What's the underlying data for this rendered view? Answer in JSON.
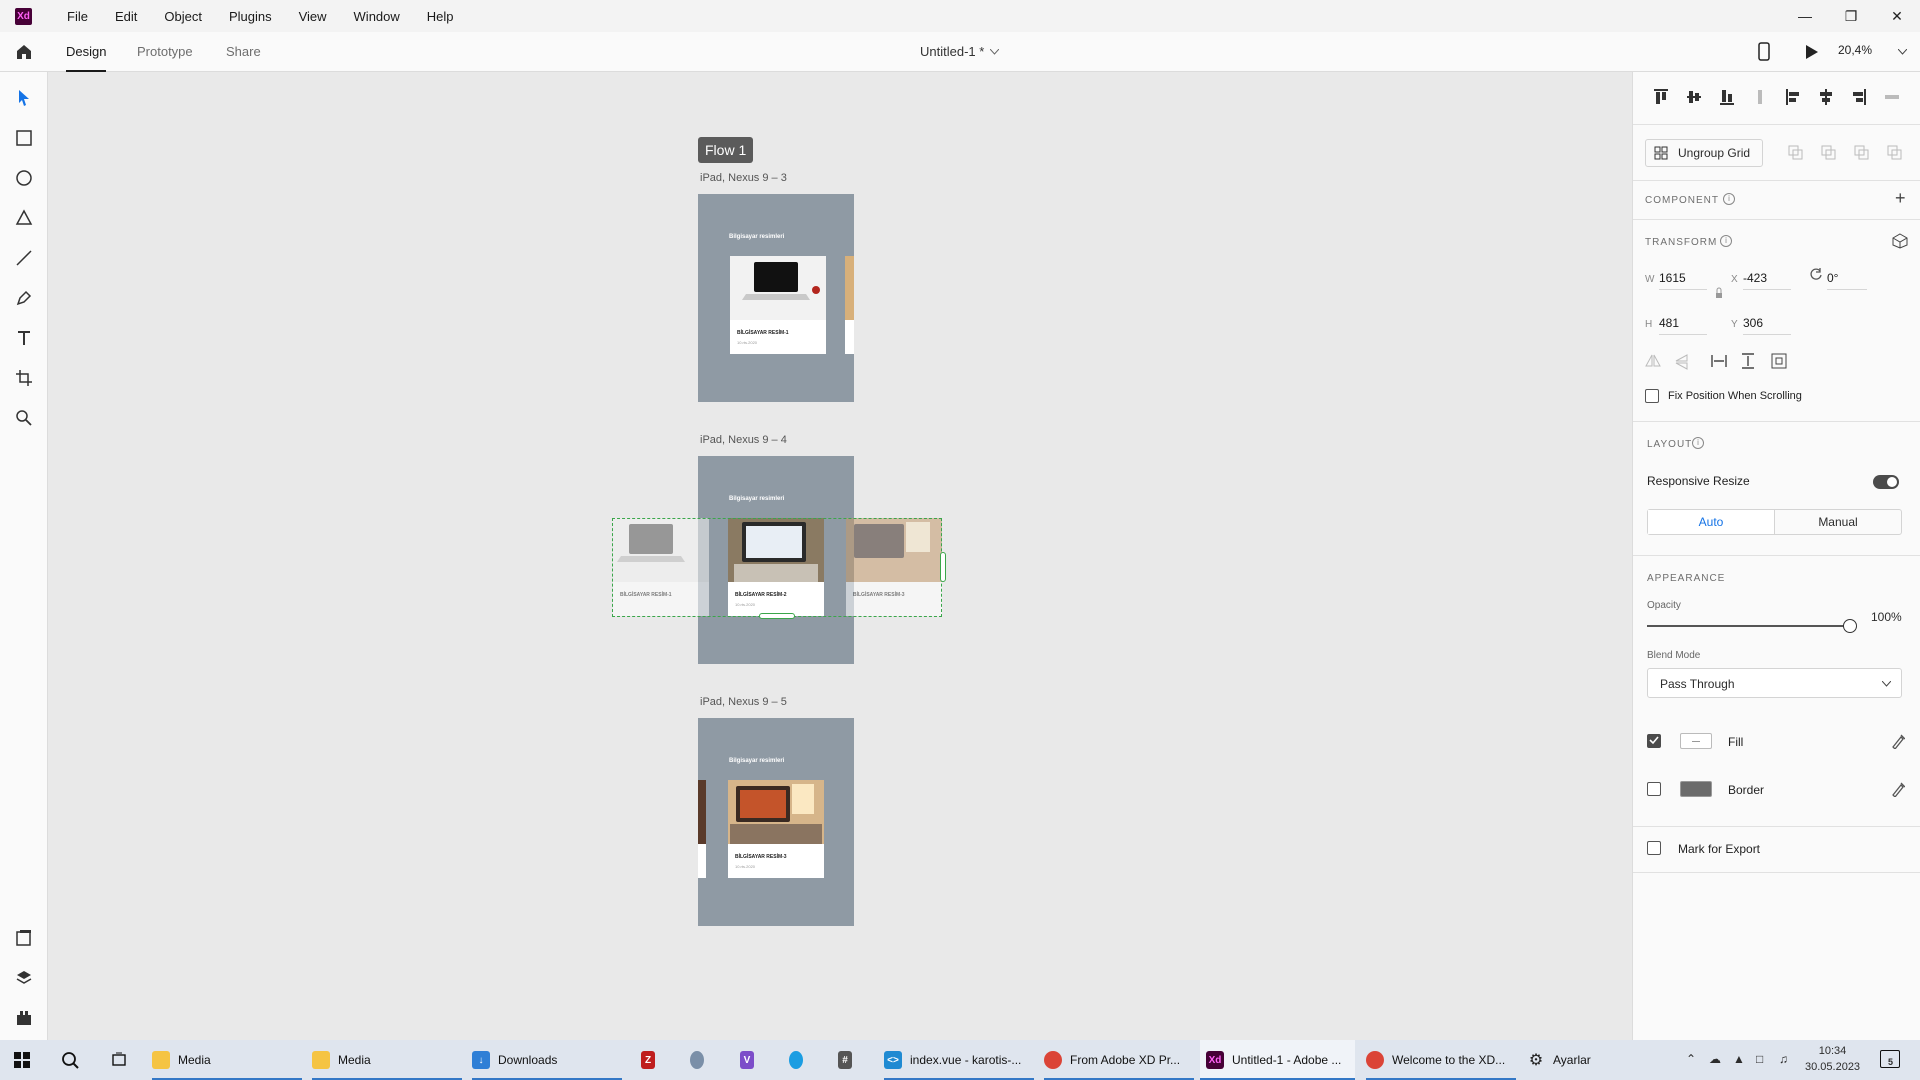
{
  "menubar": {
    "logo_text": "Xd",
    "items": [
      "File",
      "Edit",
      "Object",
      "Plugins",
      "View",
      "Window",
      "Help"
    ]
  },
  "appbar": {
    "tabs": [
      "Design",
      "Prototype",
      "Share"
    ],
    "active_tab": "Design",
    "doc_title": "Untitled-1 *",
    "zoom": "20,4%"
  },
  "canvas": {
    "flow_label": "Flow 1",
    "artboards": [
      {
        "label": "iPad, Nexus 9 – 3",
        "heading": "Bilgisayar resimleri",
        "card_title": "BİLGİSAYAR RESİM-1",
        "card_sub": "10.rts.2020"
      },
      {
        "label": "iPad, Nexus 9 – 4",
        "heading": "Bilgisayar resimleri",
        "card_title": "BİLGİSAYAR RESİM-2",
        "card_sub": "10.rts.2020",
        "left_card_title": "BİLGİSAYAR RESİM-1",
        "right_card_title": "BİLGİSAYAR RESİM-3"
      },
      {
        "label": "iPad, Nexus 9 – 5",
        "heading": "Bilgisayar resimleri",
        "card_title": "BİLGİSAYAR RESİM-3",
        "card_sub": "10.rts.2020"
      }
    ]
  },
  "props": {
    "ungroup_label": "Ungroup Grid",
    "component_label": "COMPONENT",
    "transform_label": "TRANSFORM",
    "w_key": "W",
    "w_val": "1615",
    "h_key": "H",
    "h_val": "481",
    "x_key": "X",
    "x_val": "-423",
    "y_key": "Y",
    "y_val": "306",
    "rotation": "0°",
    "fix_position": "Fix Position When Scrolling",
    "layout_label": "LAYOUT",
    "responsive_resize": "Responsive Resize",
    "auto_label": "Auto",
    "manual_label": "Manual",
    "appearance_label": "APPEARANCE",
    "opacity_label": "Opacity",
    "opacity_val": "100%",
    "blend_label": "Blend Mode",
    "blend_val": "Pass Through",
    "fill_label": "Fill",
    "border_label": "Border",
    "export_label": "Mark for Export"
  },
  "taskbar": {
    "apps": [
      {
        "label": "Media"
      },
      {
        "label": "Media"
      },
      {
        "label": "Downloads"
      },
      {
        "label": "index.vue - karotis-..."
      },
      {
        "label": "From Adobe XD Pr..."
      },
      {
        "label": "Untitled-1 - Adobe ..."
      },
      {
        "label": "Welcome to the XD..."
      },
      {
        "label": "Ayarlar"
      }
    ],
    "time": "10:34",
    "date": "30.05.2023",
    "notification_count": "5"
  },
  "colors": {
    "accent": "#1473e6",
    "xd_brand": "#470137",
    "artboard_bg": "#8f9aa4",
    "selection": "#3aa64a"
  }
}
